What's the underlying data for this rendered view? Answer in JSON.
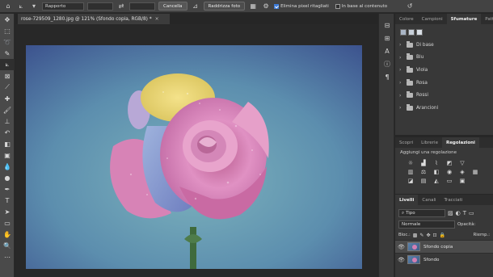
{
  "options_bar": {
    "ratio_select": "Rapporto",
    "clear_button": "Cancella",
    "straighten_button": "Raddrizza foto",
    "delete_cropped": "Elimina pixel ritagliati",
    "content_aware": "In base al contenuto"
  },
  "document": {
    "tab_title": "rose-729509_1280.jpg @ 121% (Sfondo copia, RGB/8) *",
    "close_glyph": "×"
  },
  "gradient_panel": {
    "tabs": [
      "Colore",
      "Campioni",
      "Sfumature",
      "Pattern"
    ],
    "active_tab": "Sfumature",
    "folders": [
      "Di base",
      "Blu",
      "Viola",
      "Rosa",
      "Rossi",
      "Arancioni"
    ]
  },
  "adjust_panel": {
    "tabs": [
      "Scopri",
      "Librerie",
      "Regolazioni"
    ],
    "active_tab": "Regolazioni",
    "subtitle": "Aggiungi una regolazione"
  },
  "layers_panel": {
    "tabs": [
      "Livelli",
      "Canali",
      "Tracciati"
    ],
    "active_tab": "Livelli",
    "filter_label": "Tipo",
    "blend_mode": "Normale",
    "opacity_label": "Opacità:",
    "lock_label": "Bloc.:",
    "fill_label": "Riemp.:",
    "layers": [
      {
        "name": "Sfondo copia",
        "selected": true
      },
      {
        "name": "Sfondo",
        "selected": false
      }
    ]
  },
  "colors": {
    "panel_bg": "#383838",
    "accent": "#3e7cd8"
  }
}
